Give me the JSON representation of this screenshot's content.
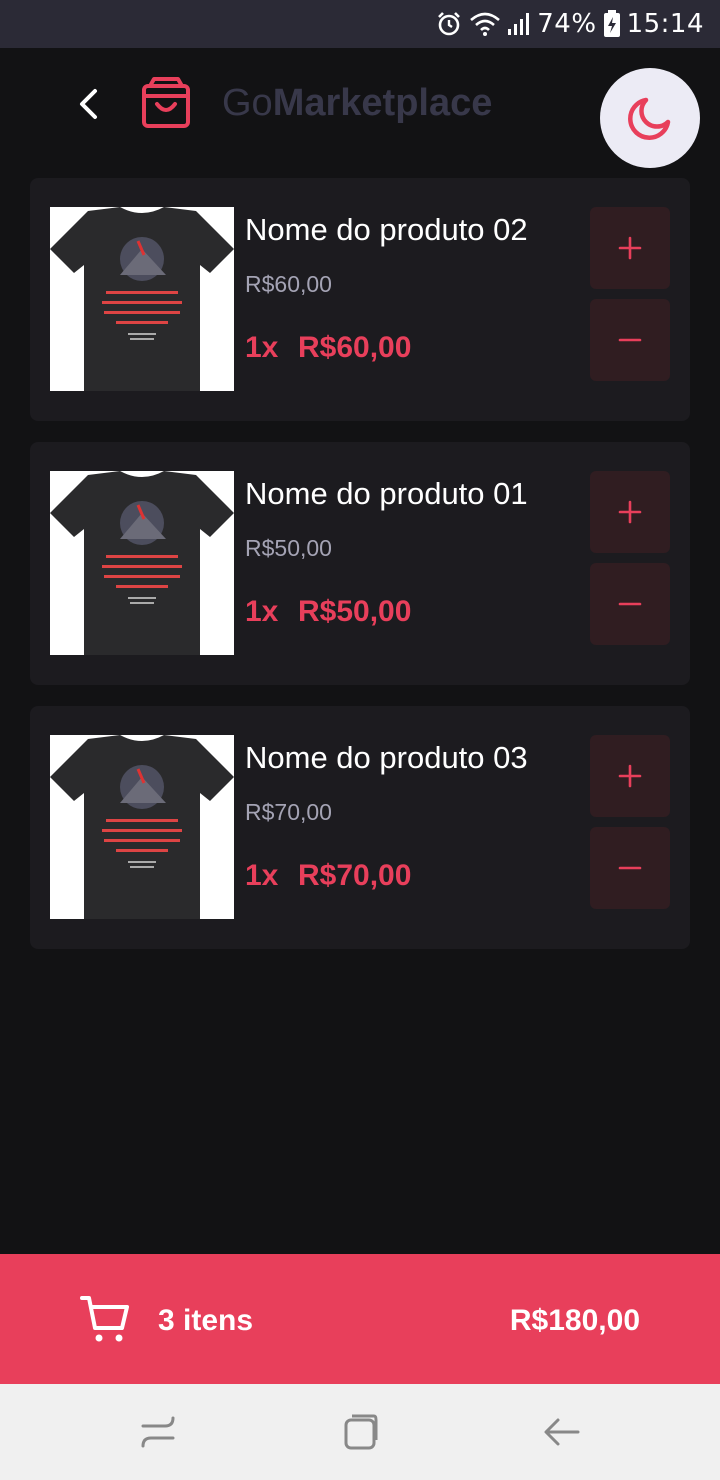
{
  "status_bar": {
    "battery": "74%",
    "time": "15:14",
    "icons": [
      "alarm-icon",
      "wifi-icon",
      "signal-icon",
      "battery-charging-icon"
    ]
  },
  "header": {
    "title_light": "Go",
    "title_bold": "Marketplace",
    "icons": [
      "back-arrow-icon",
      "shopping-bag-icon",
      "moon-icon"
    ]
  },
  "products": [
    {
      "title": "Nome do produto 02",
      "unit_price": "R$60,00",
      "quantity": "1x",
      "subtotal": "R$60,00"
    },
    {
      "title": "Nome do produto 01",
      "unit_price": "R$50,00",
      "quantity": "1x",
      "subtotal": "R$50,00"
    },
    {
      "title": "Nome do produto 03",
      "unit_price": "R$70,00",
      "quantity": "1x",
      "subtotal": "R$70,00"
    }
  ],
  "cart": {
    "count_label": "3 itens",
    "total": "R$180,00"
  },
  "colors": {
    "background": "#121214",
    "card": "#1c1b1f",
    "accent": "#e83f5b",
    "qty_button": "#301d21",
    "status_bar": "#2b2a36",
    "nav_bar": "#f0f0f0"
  }
}
